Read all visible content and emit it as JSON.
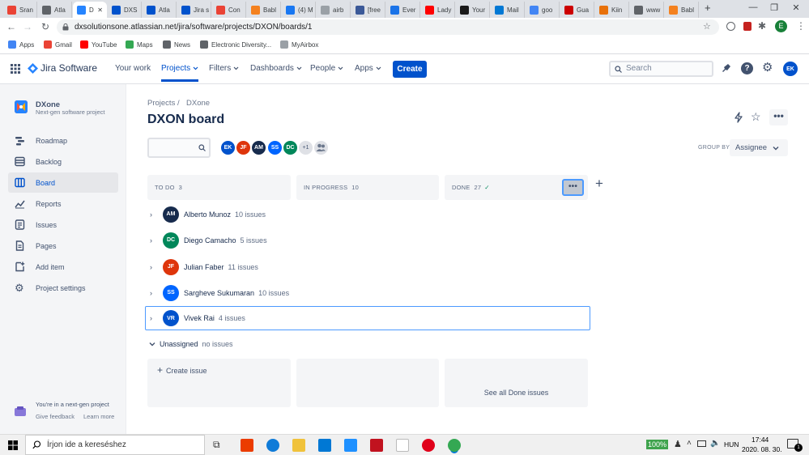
{
  "browser": {
    "tabs": [
      {
        "label": "Sran",
        "color": "#ea4335"
      },
      {
        "label": "Atla",
        "color": "#5f6368"
      },
      {
        "label": "D",
        "color": "#2684ff",
        "active": true
      },
      {
        "label": "DXS",
        "color": "#0052cc"
      },
      {
        "label": "Atla",
        "color": "#0052cc"
      },
      {
        "label": "Jira s",
        "color": "#0052cc"
      },
      {
        "label": "Con",
        "color": "#ea4335"
      },
      {
        "label": "Babl",
        "color": "#f4811f"
      },
      {
        "label": "(4) M",
        "color": "#1877f2"
      },
      {
        "label": "airb",
        "color": "#9aa0a6"
      },
      {
        "label": "[free",
        "color": "#3b5998"
      },
      {
        "label": "Ever",
        "color": "#1a73e8"
      },
      {
        "label": "Lady",
        "color": "#ff0000"
      },
      {
        "label": "Your",
        "color": "#1a1a1a"
      },
      {
        "label": "Mail",
        "color": "#0078d4"
      },
      {
        "label": "goo",
        "color": "#4285f4"
      },
      {
        "label": "Gua",
        "color": "#c00"
      },
      {
        "label": "Kiin",
        "color": "#e8710a"
      },
      {
        "label": "www",
        "color": "#5f6368"
      },
      {
        "label": "Babl",
        "color": "#f4811f"
      }
    ],
    "new_tab": "+",
    "url": "dxsolutionsone.atlassian.net/jira/software/projects/DXON/boards/1",
    "profile_initial": "E",
    "bookmarks": [
      {
        "label": "Apps",
        "color": "#4285f4"
      },
      {
        "label": "Gmail",
        "color": "#ea4335"
      },
      {
        "label": "YouTube",
        "color": "#ff0000"
      },
      {
        "label": "Maps",
        "color": "#34a853"
      },
      {
        "label": "News",
        "color": "#5f6368"
      },
      {
        "label": "Electronic Diversity...",
        "color": "#5f6368"
      },
      {
        "label": "MyAirbox",
        "color": "#9aa0a6"
      }
    ]
  },
  "jira": {
    "product_name": "Jira Software",
    "nav": {
      "your_work": "Your work",
      "projects": "Projects",
      "filters": "Filters",
      "dashboards": "Dashboards",
      "people": "People",
      "apps": "Apps",
      "create": "Create"
    },
    "search_placeholder": "Search",
    "user_initials": "EK",
    "project": {
      "name": "DXone",
      "type": "Next-gen software project"
    },
    "sidebar": [
      {
        "label": "Roadmap",
        "icon": "roadmap-icon"
      },
      {
        "label": "Backlog",
        "icon": "backlog-icon"
      },
      {
        "label": "Board",
        "icon": "board-icon",
        "active": true
      },
      {
        "label": "Reports",
        "icon": "reports-icon"
      },
      {
        "label": "Issues",
        "icon": "issues-icon"
      },
      {
        "label": "Pages",
        "icon": "pages-icon"
      },
      {
        "label": "Add item",
        "icon": "add-item-icon"
      },
      {
        "label": "Project settings",
        "icon": "settings-icon"
      }
    ],
    "sidebar_footer": {
      "message": "You're in a next-gen project",
      "give_feedback": "Give feedback",
      "learn_more": "Learn more"
    },
    "breadcrumb": {
      "projects": "Projects",
      "separator": "/",
      "project": "DXone"
    },
    "board_title": "DXON board",
    "avatars": [
      {
        "initials": "EK",
        "color": "#0052cc"
      },
      {
        "initials": "JF",
        "color": "#de350b"
      },
      {
        "initials": "AM",
        "color": "#172b4d"
      },
      {
        "initials": "SS",
        "color": "#0065ff"
      },
      {
        "initials": "DC",
        "color": "#00875a"
      }
    ],
    "more_avatars": "+1",
    "group_by_label": "GROUP BY",
    "group_by_value": "Assignee",
    "columns": [
      {
        "label": "TO DO",
        "count": "3"
      },
      {
        "label": "IN PROGRESS",
        "count": "10"
      },
      {
        "label": "DONE",
        "count": "27",
        "check": "✓"
      }
    ],
    "swimlanes": [
      {
        "initials": "AM",
        "name": "Alberto Munoz",
        "count": "10 issues",
        "color": "#172b4d"
      },
      {
        "initials": "DC",
        "name": "Diego Camacho",
        "count": "5 issues",
        "color": "#00875a"
      },
      {
        "initials": "JF",
        "name": "Julian Faber",
        "count": "11 issues",
        "color": "#de350b"
      },
      {
        "initials": "SS",
        "name": "Sargheve Sukumaran",
        "count": "10 issues",
        "color": "#0065ff"
      },
      {
        "initials": "VR",
        "name": "Vivek Rai",
        "count": "4 issues",
        "color": "#0052cc",
        "selected": true
      }
    ],
    "unassigned": {
      "label": "Unassigned",
      "count": "no issues"
    },
    "create_issue": "Create issue",
    "see_all_done": "See all Done issues"
  },
  "taskbar": {
    "search_placeholder": "Írjon ide a kereséshez",
    "battery": "100%",
    "language": "HUN",
    "time": "17:44",
    "date": "2020. 08. 30.",
    "notification_count": "1"
  }
}
